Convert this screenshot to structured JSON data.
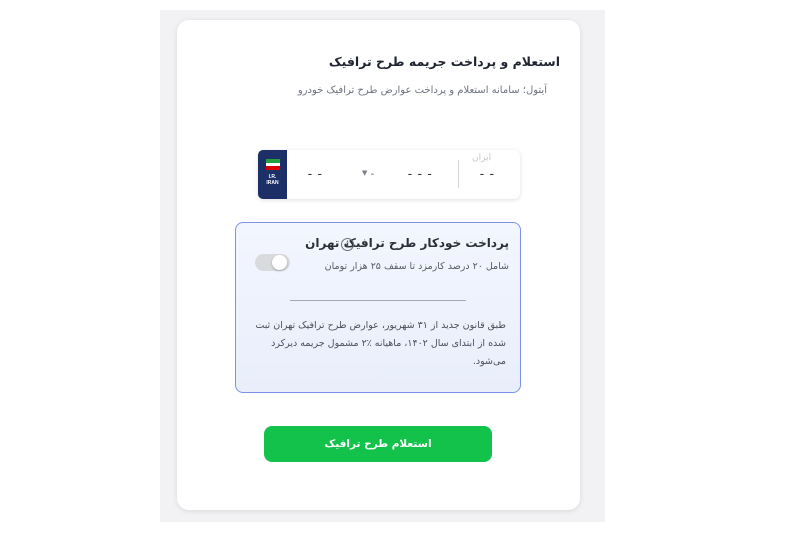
{
  "card": {
    "title": "استعلام و پرداخت جریمه طرح ترافیک",
    "subtitle": "آیتول؛ سامانه استعلام و پرداخت عوارض طرح ترافیک خودرو"
  },
  "plate": {
    "flag_text_line1": "I.R.",
    "flag_text_line2": "IRAN",
    "field1": "--",
    "letter": "-",
    "field3": "---",
    "iran_label": "ایران",
    "iran_code": "--",
    "flag_colors": [
      "#239f40",
      "#ffffff",
      "#da0000"
    ]
  },
  "autopay": {
    "title": "پرداخت خودکار طرح ترافیک تهران",
    "info_icon": "info-icon",
    "subtitle": "شامل ۲۰ درصد کارمزد تا سقف ۲۵ هزار تومان",
    "toggle_on": false,
    "note": "طبق قانون جدید از ۳۱ شهریور، عوارض طرح ترافیک تهران ثبت شده از ابتدای سال ۱۴۰۲، ماهیانه ٪۲ مشمول جریمه دیرکرد می‌شود."
  },
  "submit": {
    "label": "استعلام طرح ترافیک",
    "color": "#13c24a"
  }
}
